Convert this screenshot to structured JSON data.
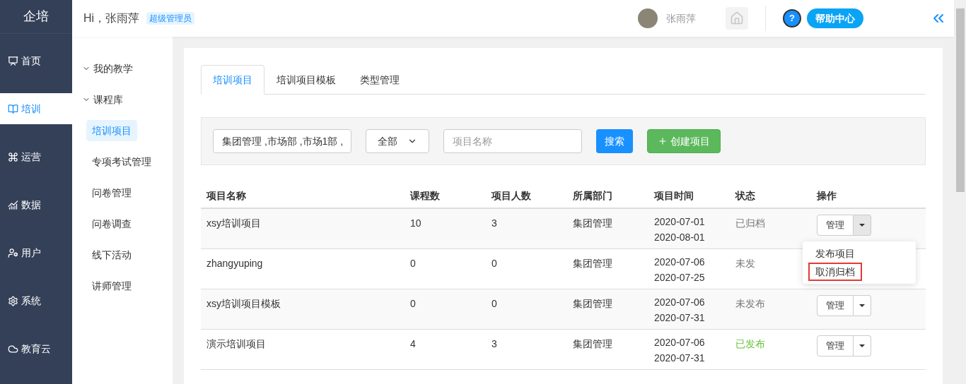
{
  "brand": "企培",
  "nav": [
    {
      "label": "首页",
      "selected": false
    },
    {
      "label": "培训",
      "selected": true
    },
    {
      "label": "运营",
      "selected": false
    },
    {
      "label": "数据",
      "selected": false
    },
    {
      "label": "用户",
      "selected": false
    },
    {
      "label": "系统",
      "selected": false
    },
    {
      "label": "教育云",
      "selected": false
    }
  ],
  "header": {
    "greeting": "Hi，张雨萍",
    "role_badge": "超级管理员",
    "user_name": "张雨萍",
    "help_glyph": "?",
    "help_label": "帮助中心"
  },
  "sub_nav": [
    {
      "label": "我的教学",
      "kind": "group",
      "expanded": true
    },
    {
      "label": "课程库",
      "kind": "group",
      "expanded": true
    },
    {
      "label": "培训项目",
      "kind": "item",
      "selected": true
    },
    {
      "label": "专项考试管理",
      "kind": "item",
      "selected": false
    },
    {
      "label": "问卷管理",
      "kind": "item",
      "selected": false
    },
    {
      "label": "问卷调查",
      "kind": "item",
      "selected": false
    },
    {
      "label": "线下活动",
      "kind": "item",
      "selected": false
    },
    {
      "label": "讲师管理",
      "kind": "item",
      "selected": false
    }
  ],
  "tabs": [
    {
      "label": "培训项目",
      "selected": true
    },
    {
      "label": "培训项目模板",
      "selected": false
    },
    {
      "label": "类型管理",
      "selected": false
    }
  ],
  "filters": {
    "department": "集团管理 ,市场部 ,市场1部 ,",
    "status_select": "全部",
    "name_placeholder": "项目名称",
    "search_button": "搜索",
    "create_button": "创建项目"
  },
  "table": {
    "columns": [
      "项目名称",
      "课程数",
      "项目人数",
      "所属部门",
      "项目时间",
      "状态",
      "操作"
    ],
    "rows": [
      {
        "name": "xsy培训项目",
        "courses": "10",
        "people": "3",
        "department": "集团管理",
        "start": "2020-07-01",
        "end": "2020-08-01",
        "status": "已归档",
        "color": "#777777",
        "action": "管理",
        "menu_open": true
      },
      {
        "name": "zhangyuping",
        "courses": "0",
        "people": "0",
        "department": "集团管理",
        "start": "2020-07-06",
        "end": "2020-07-25",
        "status": "未发",
        "color": "#777777"
      },
      {
        "name": "xsy培训项目模板",
        "courses": "0",
        "people": "0",
        "department": "集团管理",
        "start": "2020-07-06",
        "end": "2020-07-31",
        "status": "未发布",
        "color": "#777777",
        "action": "管理",
        "menu_open": false
      },
      {
        "name": "演示培训项目",
        "courses": "4",
        "people": "3",
        "department": "集团管理",
        "start": "2020-07-06",
        "end": "2020-07-31",
        "status": "已发布",
        "color": "#67c23a",
        "action": "管理",
        "menu_open": false
      }
    ],
    "menu": [
      {
        "label": "发布项目",
        "highlighted": false
      },
      {
        "label": "取消归档",
        "highlighted": true
      }
    ]
  }
}
